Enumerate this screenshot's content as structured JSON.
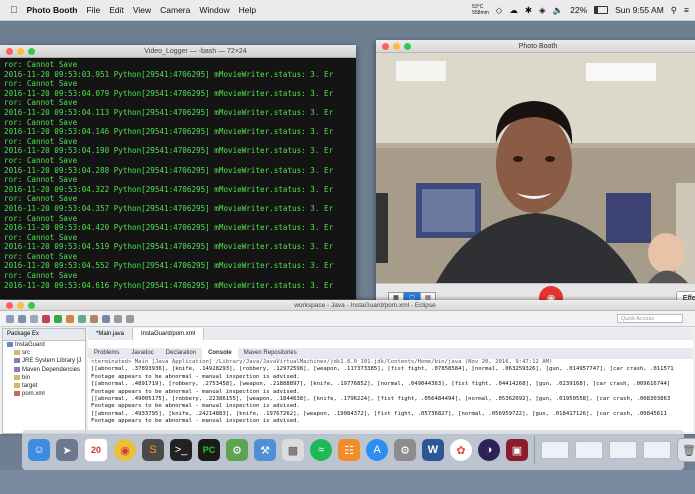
{
  "menubar": {
    "app": "Photo Booth",
    "items": [
      "File",
      "Edit",
      "View",
      "Camera",
      "Window",
      "Help"
    ],
    "weather_temp": "53°C",
    "weather_sub": "558mm",
    "battery": "22%",
    "clock": "Sun 9:55 AM"
  },
  "terminal": {
    "title": "Video_Logger — -bash — 72×24",
    "lines": [
      "ror: Cannot Save",
      "2016-11-20 09:53:03.951 Python[29541:4706295] mMovieWriter.status: 3. Er",
      "ror: Cannot Save",
      "2016-11-20 09:53:04.079 Python[29541:4706295] mMovieWriter.status: 3. Er",
      "ror: Cannot Save",
      "2016-11-20 09:53:04.113 Python[29541:4706295] mMovieWriter.status: 3. Er",
      "ror: Cannot Save",
      "2016-11-20 09:53:04.146 Python[29541:4706295] mMovieWriter.status: 3. Er",
      "ror: Cannot Save",
      "2016-11-20 09:53:04.190 Python[29541:4706295] mMovieWriter.status: 3. Er",
      "ror: Cannot Save",
      "2016-11-20 09:53:04.288 Python[29541:4706295] mMovieWriter.status: 3. Er",
      "ror: Cannot Save",
      "2016-11-20 09:53:04.322 Python[29541:4706295] mMovieWriter.status: 3. Er",
      "ror: Cannot Save",
      "2016-11-20 09:53:04.357 Python[29541:4706295] mMovieWriter.status: 3. Er",
      "ror: Cannot Save",
      "2016-11-20 09:53:04.420 Python[29541:4706295] mMovieWriter.status: 3. Er",
      "ror: Cannot Save",
      "2016-11-20 09:53:04.519 Python[29541:4706295] mMovieWriter.status: 3. Er",
      "ror: Cannot Save",
      "2016-11-20 09:53:04.552 Python[29541:4706295] mMovieWriter.status: 3. Er",
      "ror: Cannot Save",
      "2016-11-20 09:53:04.616 Python[29541:4706295] mMovieWriter.status: 3. Er"
    ]
  },
  "photobooth": {
    "title": "Photo Booth",
    "effects_label": "Effe"
  },
  "eclipse": {
    "title": "workspace - Java - InstaGuard/pom.xml - Eclipse",
    "quick_access": "Quick Access",
    "package_explorer_tab": "Package Ex",
    "tree": [
      "InstaGuard",
      "src",
      "JRE System Library [J",
      "Maven Dependencies",
      "bin",
      "target",
      "pom.xml"
    ],
    "editor_tabs": [
      "*Main.java",
      "InstaGuard/pom.xml"
    ],
    "console_tabs": [
      "Problems",
      "Javadoc",
      "Declaration",
      "Console",
      "Maven Repositories"
    ],
    "console_lines": [
      "<terminated> Main [Java Application] /Library/Java/JavaVirtualMachines/jdk1.8.0_101.jdk/Contents/Home/bin/java (Nov 20, 2016, 9:47:12 AM)",
      "[[abnormal, .37893936], [knife, .14928293], [robbery, .12972598], [weapon, .117373385], [fist fight, .07858584], [normal, .063259326], [gun, .014957747], [car crash, .011571",
      "Footage appears to be abnormal - manual inspection is advised.",
      "[[abnormal, .4891719], [robbery, .2753458], [weapon, .21888897], [knife, .19776852], [normal, .049044363], [fist fight, .04414268], [gun, .0239168], [car crash, .009616744]",
      "Footage appears to be abnormal - manual inspection is advised.",
      "[[abnormal, .49005175], [robbery, .22386155], [weapon, .1844638], [knife, .1796224], [fist fight, .056484494], [normal, .05362692], [gun, .01950558], [car crash, .008303863",
      "Footage appears to be abnormal - manual inspection is advised.",
      "[[abnormal, .4933795], [knife, .24214883], [knife, .19767262], [weapon, .19084372], [fist fight, .05736827], [normal, .056959722], [gun, .018417126], [car crash, .00845611",
      "Footage appears to be abnormal - manual inspection is advised."
    ]
  },
  "dock": {
    "calendar_day": "20",
    "apps": [
      "finder",
      "launchpad",
      "chrome",
      "sublime-text",
      "terminal",
      "pycharm",
      "android-studio",
      "xcode",
      "preview",
      "spotify",
      "ibooks",
      "app-store",
      "system-preferences",
      "word",
      "photos",
      "eclipse",
      "photo-booth"
    ]
  }
}
